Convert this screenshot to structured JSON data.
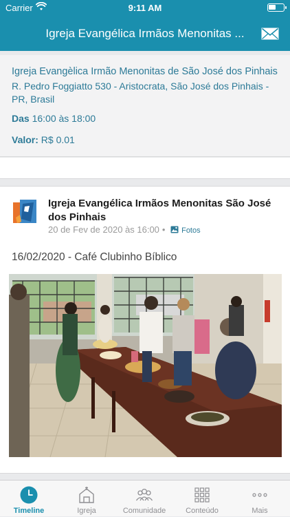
{
  "status_bar": {
    "carrier": "Carrier",
    "time": "9:11 AM"
  },
  "header": {
    "title": "Igreja Evangélica Irmãos Menonitas ...",
    "icon": "mail-icon"
  },
  "event": {
    "name": "Igreja Evangèlica Irmão Menonitas de São José dos Pinhais",
    "address": "R. Pedro Foggiatto 530 - Aristocrata, São José dos Pinhais - PR, Brasil",
    "hours_label": "Das",
    "hours_value": "16:00 às 18:00",
    "value_label": "Valor:",
    "value_amount": "R$ 0.01"
  },
  "post": {
    "author": "Igreja Evangélica Irmãos Menonitas São José dos Pinhais",
    "date": "20 de Fev de 2020 às 16:00",
    "separator": "•",
    "photos_label": "Fotos",
    "title": "16/02/2020 - Café Clubinho Bíblico"
  },
  "tabs": [
    {
      "label": "Timeline",
      "icon": "clock-icon",
      "active": true
    },
    {
      "label": "Igreja",
      "icon": "church-icon",
      "active": false
    },
    {
      "label": "Comunidade",
      "icon": "people-icon",
      "active": false
    },
    {
      "label": "Conteúdo",
      "icon": "grid-icon",
      "active": false
    },
    {
      "label": "Mais",
      "icon": "more-icon",
      "active": false
    }
  ],
  "colors": {
    "primary": "#1a8fae",
    "link": "#2c7a97",
    "background": "#e9eaec"
  }
}
